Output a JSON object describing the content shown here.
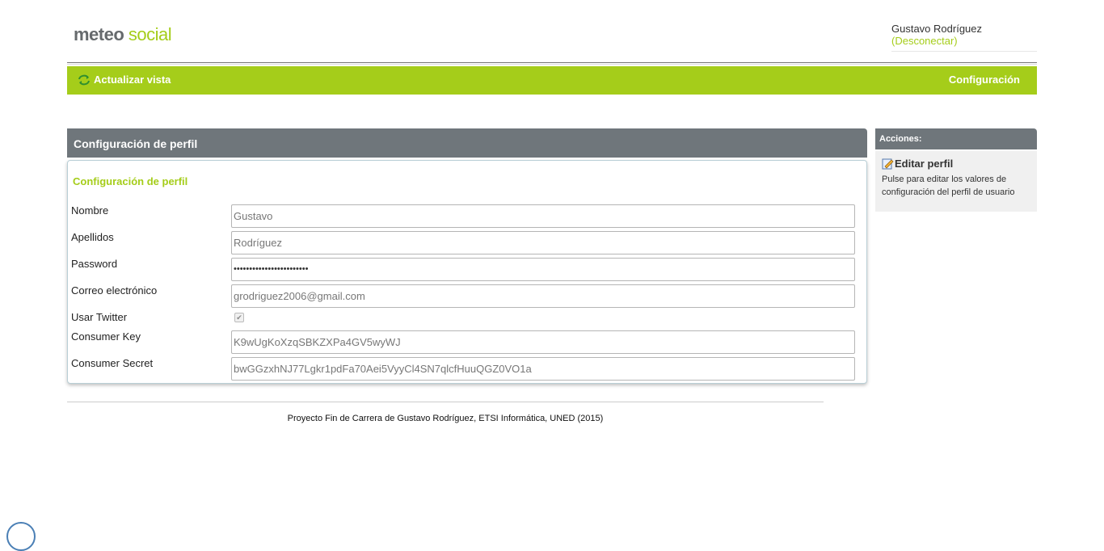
{
  "header": {
    "logo_part1": "meteo",
    "logo_part2": "social",
    "user_name": "Gustavo Rodríguez",
    "logout_label": "(Desconectar)"
  },
  "navbar": {
    "refresh_label": "Actualizar vista",
    "config_label": "Configuración"
  },
  "main": {
    "panel_title": "Configuración de perfil",
    "section_title": "Configuración de perfil",
    "fields": {
      "nombre": {
        "label": "Nombre",
        "value": "Gustavo"
      },
      "apellidos": {
        "label": "Apellidos",
        "value": "Rodríguez"
      },
      "password": {
        "label": "Password",
        "value": "••••••••••••••••••••••••"
      },
      "correo": {
        "label": "Correo electrónico",
        "value": "grodriguez2006@gmail.com"
      },
      "twitter": {
        "label": "Usar Twitter",
        "checked": true
      },
      "consumer_key": {
        "label": "Consumer Key",
        "value": "K9wUgKoXzqSBKZXPa4GV5wyWJ"
      },
      "consumer_secret": {
        "label": "Consumer Secret",
        "value": "bwGGzxhNJ77Lgkr1pdFa70Aei5VyyCl4SN7qlcfHuuQGZ0VO1a"
      }
    }
  },
  "sidebar": {
    "title": "Acciones:",
    "action_label": "Editar perfil",
    "action_desc": "Pulse para editar los valores de configuración del perfil de usuario"
  },
  "footer": {
    "text": "Proyecto Fin de Carrera de Gustavo Rodríguez, ETSI Informática, UNED (2015)"
  },
  "colors": {
    "accent": "#a5cd1a",
    "panel_header": "#6f767b",
    "logo_gray": "#666a6d"
  },
  "icons": [
    "refresh-icon",
    "edit-icon",
    "checkmark-icon"
  ]
}
